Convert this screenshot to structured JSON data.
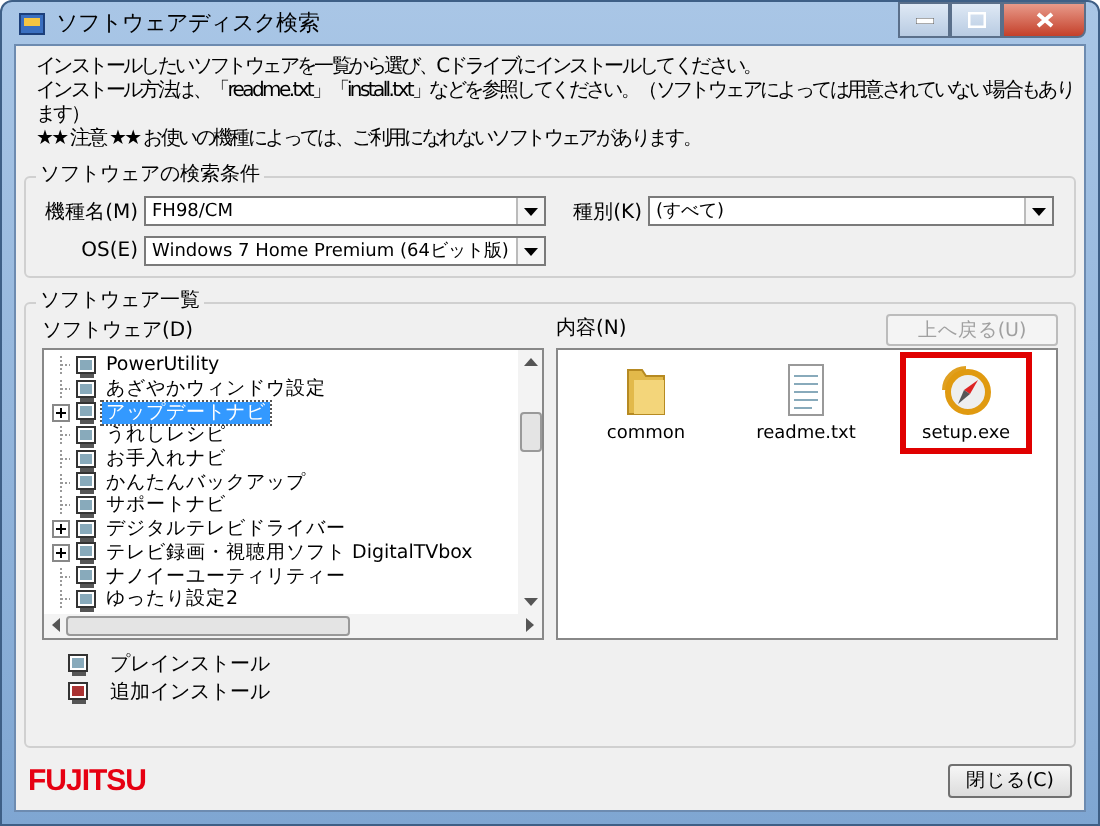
{
  "window": {
    "title": "ソフトウェアディスク検索"
  },
  "instructions": [
    "インストールしたいソフトウェアを一覧から選び、Cドライブにインストールしてください。",
    "インストール方法は、「readme.txt」「install.txt」などを参照してください。（ソフトウェアによっては用意されていない場合もあります）",
    "★★ 注意 ★★ お使いの機種によっては、ご利用になれないソフトウェアがあります。"
  ],
  "search_conditions": {
    "title": "ソフトウェアの検索条件",
    "fields": [
      {
        "label": "機種名(M)",
        "value": "FH98/CM"
      },
      {
        "label": "種別(K)",
        "value": "(すべて)"
      },
      {
        "label": "OS(E)",
        "value": "Windows 7 Home Premium (64ビット版)"
      }
    ]
  },
  "software_list": {
    "title": "ソフトウェア一覧",
    "tree_label": "ソフトウェア(D)",
    "items": [
      {
        "label": "PowerUtility",
        "expander": false,
        "selected": false
      },
      {
        "label": "あざやかウィンドウ設定",
        "expander": false,
        "selected": false
      },
      {
        "label": "アップデートナビ",
        "expander": true,
        "selected": true
      },
      {
        "label": "うれしレシピ",
        "expander": false,
        "selected": false
      },
      {
        "label": "お手入れナビ",
        "expander": false,
        "selected": false
      },
      {
        "label": "かんたんバックアップ",
        "expander": false,
        "selected": false
      },
      {
        "label": "サポートナビ",
        "expander": false,
        "selected": false
      },
      {
        "label": "デジタルテレビドライバー",
        "expander": true,
        "selected": false
      },
      {
        "label": "テレビ録画・視聴用ソフト DigitalTVbox",
        "expander": true,
        "selected": false
      },
      {
        "label": "ナノイーユーティリティー",
        "expander": false,
        "selected": false
      },
      {
        "label": "ゆったり設定2",
        "expander": false,
        "selected": false
      }
    ],
    "legend": [
      {
        "kind": "preinstall",
        "label": "プレインストール"
      },
      {
        "kind": "addon",
        "label": "追加インストール"
      }
    ],
    "content_label": "内容(N)",
    "up_button": {
      "label": "上へ戻る(U)",
      "disabled": true
    },
    "files": [
      {
        "kind": "folder",
        "name": "common",
        "highlighted": false
      },
      {
        "kind": "text",
        "name": "readme.txt",
        "highlighted": false
      },
      {
        "kind": "setup",
        "name": "setup.exe",
        "highlighted": true
      }
    ]
  },
  "logo": "FUJITSU",
  "close_button": "閉じる(C)"
}
